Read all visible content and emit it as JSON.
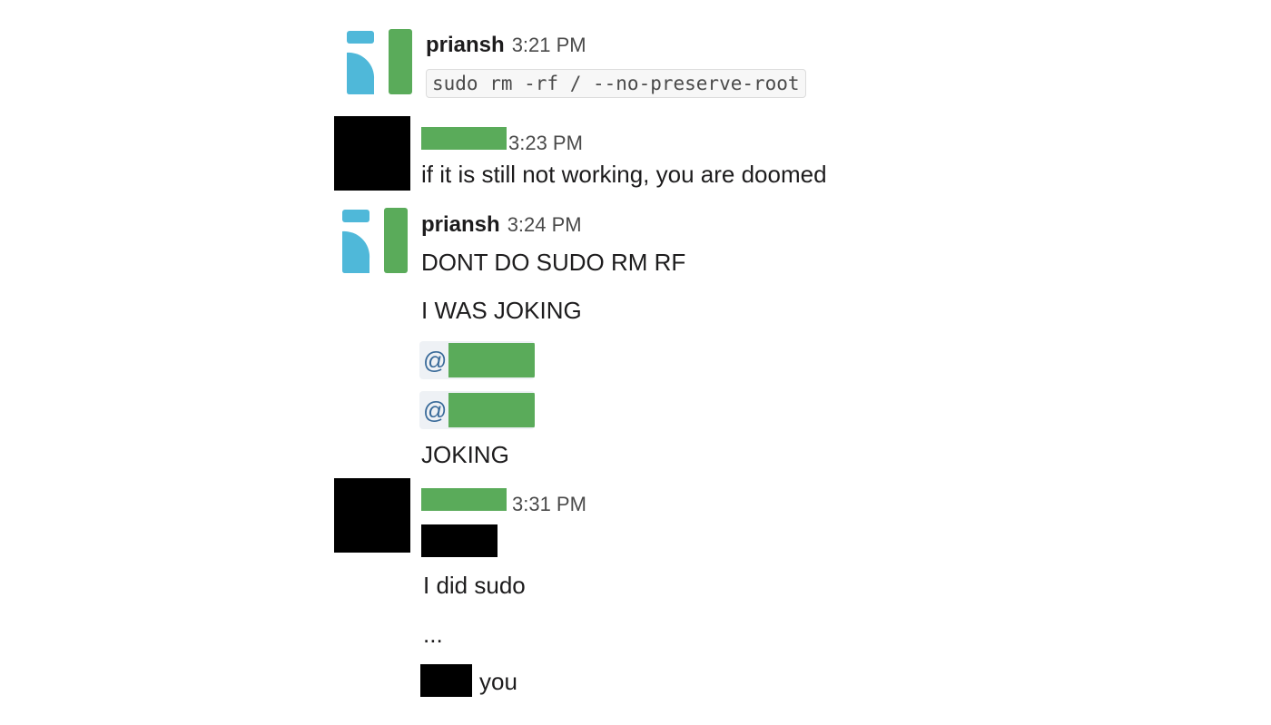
{
  "messages": [
    {
      "author": "priansh",
      "time": "3:21 PM",
      "code": "sudo rm -rf / --no-preserve-root"
    },
    {
      "time": "3:23 PM",
      "text": "if it is still not working, you are doomed"
    },
    {
      "author": "priansh",
      "time": "3:24 PM",
      "lines": [
        "DONT DO SUDO RM RF",
        "I WAS JOKING",
        "JOKING"
      ],
      "mention_prefix": "@"
    },
    {
      "time": "3:31 PM",
      "lines": [
        "I did sudo",
        "...",
        "you"
      ]
    }
  ],
  "colors": {
    "logo_blue": "#4fb8d9",
    "logo_green": "#5aab5a",
    "redaction_green": "#5aab5a",
    "redaction_black": "#000000"
  },
  "icons": {
    "priansh_avatar": "blue-green-logo-icon"
  }
}
